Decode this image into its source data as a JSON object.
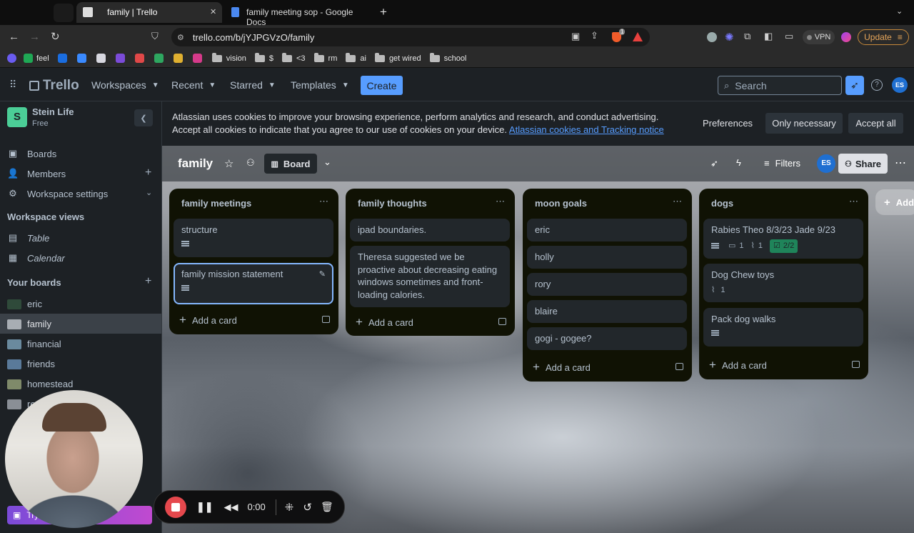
{
  "browser": {
    "tabs": [
      {
        "title": "family | Trello",
        "close": "✕"
      },
      {
        "title": "family meeting sop - Google Docs"
      }
    ],
    "new_tab": "+",
    "url": "trello.com/b/jYJPGVzO/family",
    "vpn": "VPN",
    "update": "Update",
    "extension_badge": "1",
    "bookmarks": [
      "feel",
      "vision",
      "$",
      "<3",
      "rm",
      "ai",
      "get wired",
      "school"
    ]
  },
  "header": {
    "logo": "Trello",
    "nav": [
      "Workspaces",
      "Recent",
      "Starred",
      "Templates"
    ],
    "create": "Create",
    "search_placeholder": "Search",
    "avatar": "ES"
  },
  "sidebar": {
    "workspace_initial": "S",
    "workspace_name": "Stein Life",
    "plan": "Free",
    "items": [
      "Boards",
      "Members",
      "Workspace settings"
    ],
    "views_heading": "Workspace views",
    "views": [
      "Table",
      "Calendar"
    ],
    "boards_heading": "Your boards",
    "boards": [
      "eric",
      "family",
      "financial",
      "friends",
      "homestead",
      "re"
    ]
  },
  "cookie": {
    "message": "Atlassian uses cookies to improve your browsing experience, perform analytics and research, and conduct advertising. Accept all cookies to indicate that you agree to our use of cookies on your device.",
    "link": "Atlassian cookies and Tracking notice",
    "preferences": "Preferences",
    "only_necessary": "Only necessary",
    "accept_all": "Accept all"
  },
  "board": {
    "title": "family",
    "view": "Board",
    "filters": "Filters",
    "share": "Share",
    "member": "ES",
    "add_list": "Add",
    "add_card": "Add a card",
    "lists": [
      {
        "title": "family meetings",
        "cards": [
          {
            "text": "structure"
          },
          {
            "text": "family mission statement"
          }
        ]
      },
      {
        "title": "family thoughts",
        "cards": [
          {
            "text": "ipad boundaries."
          },
          {
            "text": "Theresa suggested we be proactive about decreasing eating windows sometimes and front-loading calories."
          }
        ]
      },
      {
        "title": "moon goals",
        "cards": [
          {
            "text": "eric"
          },
          {
            "text": "holly"
          },
          {
            "text": "rory"
          },
          {
            "text": "blaire"
          },
          {
            "text": "gogi - gogee?"
          }
        ]
      },
      {
        "title": "dogs",
        "cards": [
          {
            "text": "Rabies Theo 8/3/23 Jade 9/23",
            "comments": "1",
            "attachments": "1",
            "checklist": "2/2"
          },
          {
            "text": "Dog Chew toys",
            "attachments": "1"
          },
          {
            "text": "Pack dog walks"
          }
        ]
      }
    ]
  },
  "recorder": {
    "time": "0:00",
    "try_label": "Try"
  },
  "colors": {
    "accent": "#579dff",
    "board_bg": "#1d2125",
    "list_bg": "#101204",
    "card_bg": "#22272b",
    "check_green": "#1f845a"
  }
}
